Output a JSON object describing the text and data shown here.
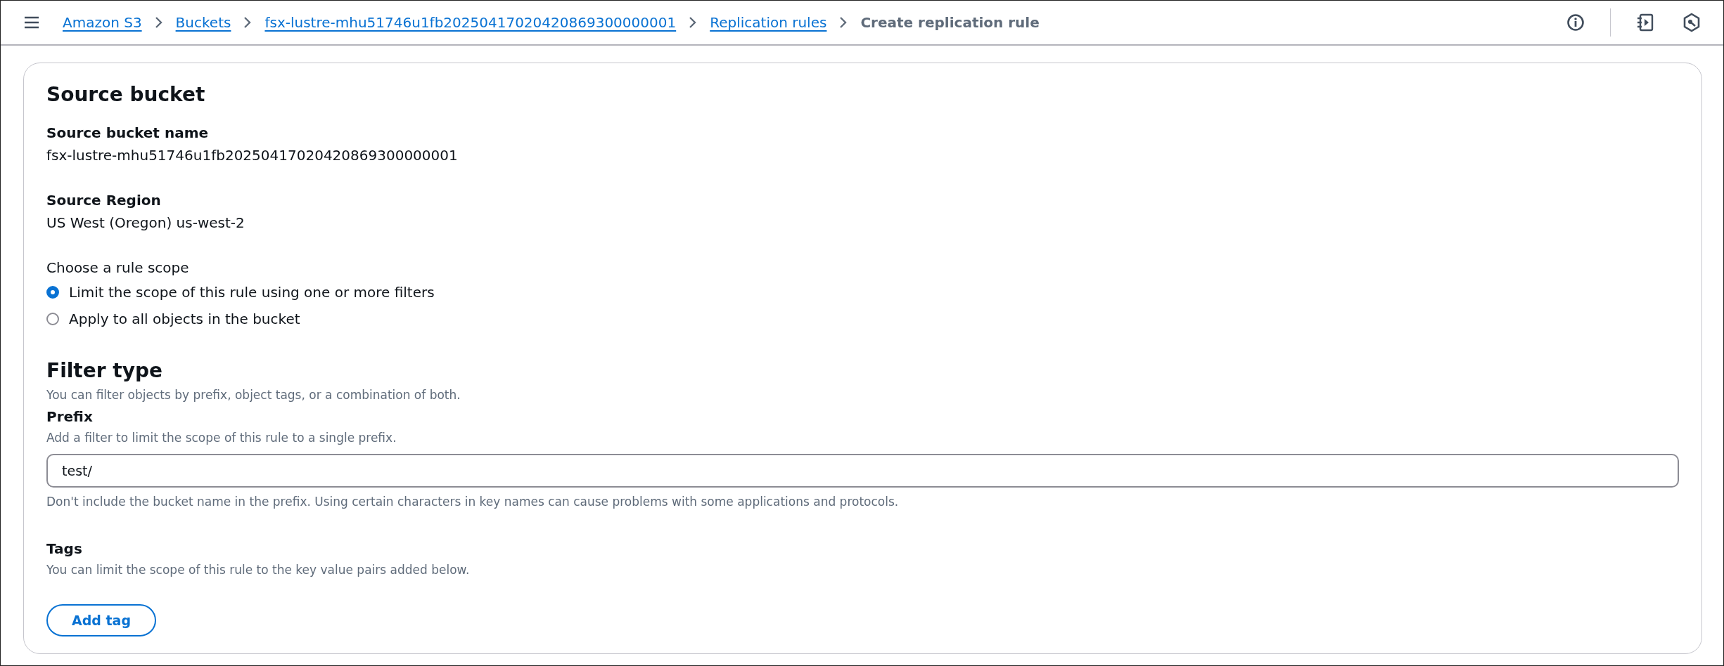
{
  "breadcrumbs": [
    {
      "label": "Amazon S3",
      "link": true
    },
    {
      "label": "Buckets",
      "link": true
    },
    {
      "label": "fsx-lustre-mhu51746u1fb20250417020420869300000001",
      "link": true
    },
    {
      "label": "Replication rules",
      "link": true
    },
    {
      "label": "Create replication rule",
      "link": false
    }
  ],
  "source_bucket": {
    "title": "Source bucket",
    "fields": [
      {
        "label": "Source bucket name",
        "value": "fsx-lustre-mhu51746u1fb20250417020420869300000001"
      },
      {
        "label": "Source Region",
        "value": "US West (Oregon) us-west-2"
      }
    ],
    "scope": {
      "label": "Choose a rule scope",
      "options": [
        {
          "label": "Limit the scope of this rule using one or more filters",
          "selected": true
        },
        {
          "label": "Apply to all objects in the bucket",
          "selected": false
        }
      ]
    }
  },
  "filter_type": {
    "title": "Filter type",
    "description": "You can filter objects by prefix, object tags, or a combination of both.",
    "prefix": {
      "label": "Prefix",
      "hint": "Add a filter to limit the scope of this rule to a single prefix.",
      "value": "test/",
      "help": "Don't include the bucket name in the prefix. Using certain characters in key names can cause problems with some applications and protocols."
    },
    "tags": {
      "label": "Tags",
      "description": "You can limit the scope of this rule to the key value pairs added below.",
      "button": "Add tag"
    }
  }
}
